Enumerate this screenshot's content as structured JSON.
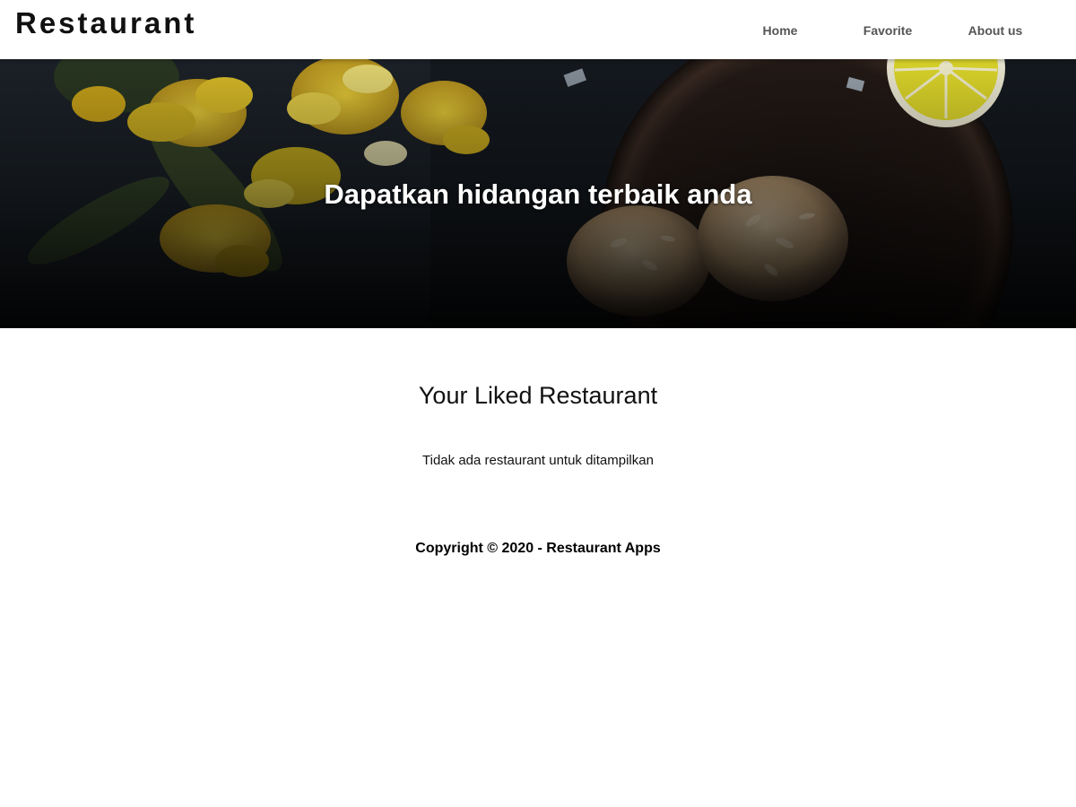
{
  "header": {
    "brand": "Restaurant",
    "nav": [
      {
        "label": "Home"
      },
      {
        "label": "Favorite"
      },
      {
        "label": "About us"
      }
    ]
  },
  "hero": {
    "title": "Dapatkan hidangan terbaik anda",
    "image": "food-photo-daffodils-lemon-cookies"
  },
  "main": {
    "title": "Your Liked Restaurant",
    "empty_message": "Tidak ada restaurant untuk ditampilkan"
  },
  "footer": {
    "copyright": "Copyright © 2020 - Restaurant Apps"
  },
  "colors": {
    "nav_text": "#555555",
    "hero_bg": "#0f1216",
    "flower": "#e0b81c",
    "lemon": "#e8e030"
  }
}
